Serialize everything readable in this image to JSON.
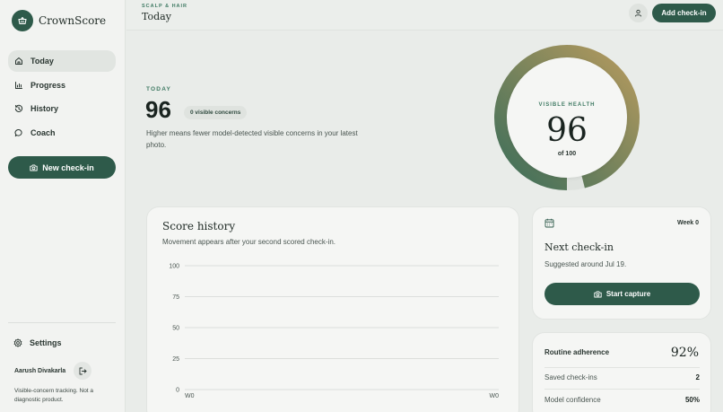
{
  "app": {
    "name": "CrownScore"
  },
  "sidebar": {
    "nav": [
      {
        "label": "Today",
        "icon": "home-icon",
        "active": true
      },
      {
        "label": "Progress",
        "icon": "bar-chart-icon",
        "active": false
      },
      {
        "label": "History",
        "icon": "history-icon",
        "active": false
      },
      {
        "label": "Coach",
        "icon": "chat-bubble-icon",
        "active": false
      }
    ],
    "new_checkin_label": "New check-in",
    "settings_label": "Settings",
    "user_name": "Aarush Divakarla",
    "disclaimer": "Visible-concern tracking. Not a diagnostic product."
  },
  "header": {
    "eyebrow": "SCALP & HAIR",
    "title": "Today",
    "add_checkin_label": "Add check-in"
  },
  "today": {
    "label": "TODAY",
    "score": "96",
    "concerns_badge": "0 visible concerns",
    "description": "Higher means fewer model-detected visible concerns in your latest photo."
  },
  "health_ring": {
    "label": "VISIBLE HEALTH",
    "score": "96",
    "of_label": "of 100",
    "value": 96,
    "max": 100
  },
  "score_history": {
    "title": "Score history",
    "subtitle": "Movement appears after your second scored check-in."
  },
  "chart_data": {
    "type": "line",
    "title": "Score history",
    "y_ticks": [
      "100",
      "75",
      "50",
      "25",
      "0"
    ],
    "x_ticks": [
      "W0",
      "W0"
    ],
    "ylim": [
      0,
      100
    ],
    "grid": true,
    "series": []
  },
  "next_checkin": {
    "week": "Week 0",
    "title": "Next check-in",
    "subtitle": "Suggested around Jul 19.",
    "button_label": "Start capture"
  },
  "routine": {
    "title": "Routine adherence",
    "percent": "92%",
    "rows": [
      {
        "label": "Saved check-ins",
        "value": "2"
      },
      {
        "label": "Model confidence",
        "value": "50%"
      }
    ]
  },
  "colors": {
    "accent": "#2e5a4a",
    "ring_start": "#b59a5e",
    "ring_end": "#3d6e5a"
  }
}
